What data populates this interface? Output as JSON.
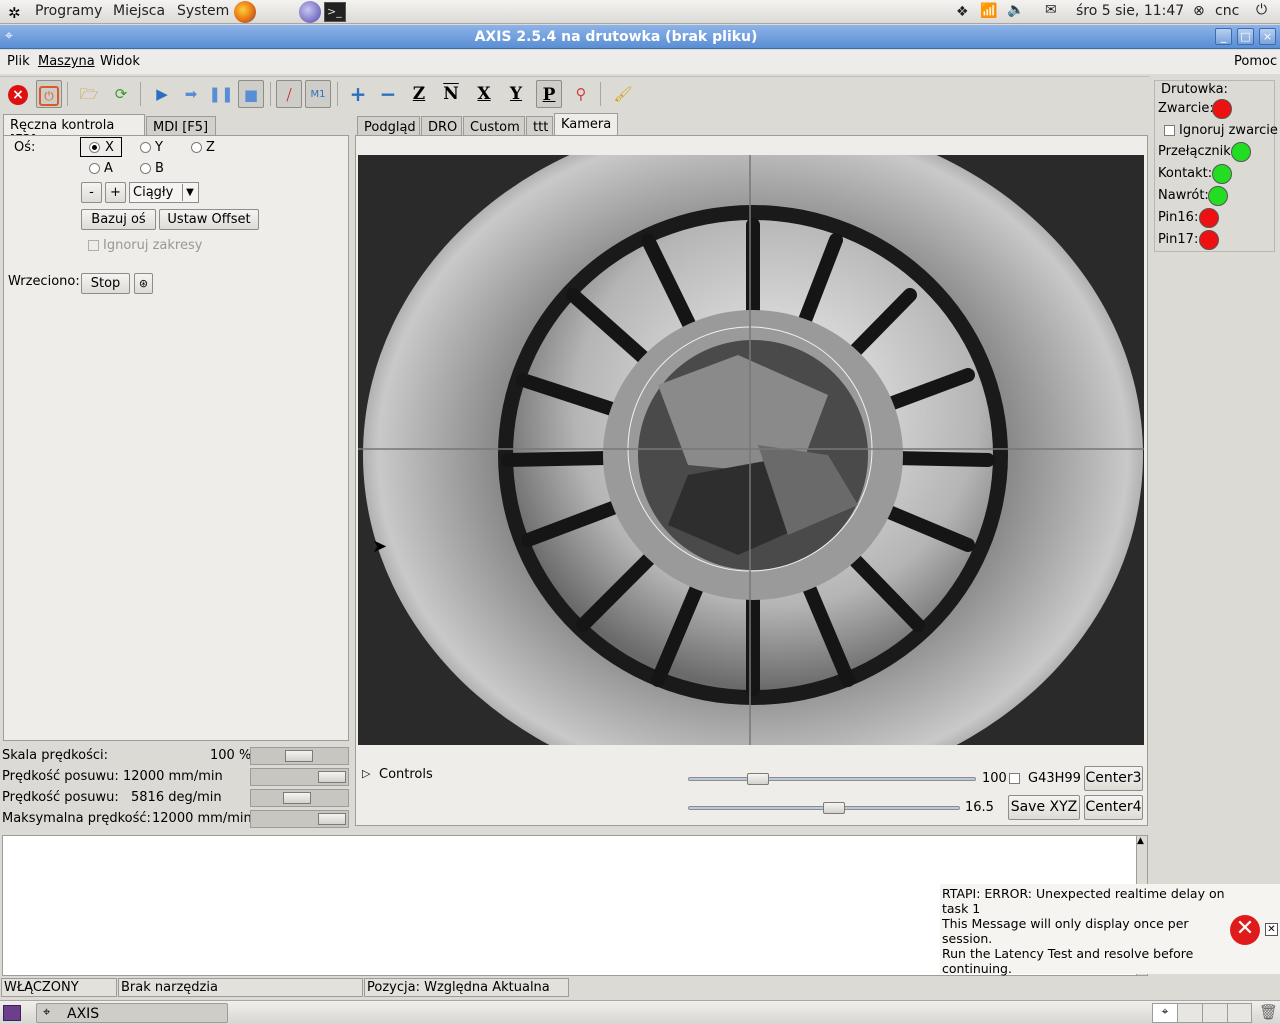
{
  "topbar": {
    "menus": [
      "Programy",
      "Miejsca",
      "System"
    ],
    "clock": "śro  5 sie, 11:47",
    "user": "cnc"
  },
  "window": {
    "title": "AXIS 2.5.4 na drutowka (brak pliku)"
  },
  "menubar": {
    "items": [
      "Plik",
      "Maszyna",
      "Widok"
    ],
    "help": "Pomoc"
  },
  "left_tabs": [
    "Ręczna kontrola [F3]",
    "MDI [F5]"
  ],
  "manual": {
    "axis_label": "Oś:",
    "axes": [
      "X",
      "Y",
      "Z",
      "A",
      "B"
    ],
    "selected_axis": "X",
    "minus": "-",
    "plus": "+",
    "jog_mode": "Ciągły",
    "home_button": "Bazuj oś",
    "offset_button": "Ustaw Offset",
    "ignore_limits": "Ignoruj zakresy",
    "spindle_label": "Wrzeciono:",
    "spindle_stop": "Stop"
  },
  "speeds": [
    {
      "label": "Skala prędkości:",
      "value": "100 %",
      "level": 0.5
    },
    {
      "label": "Prędkość posuwu:",
      "value": "12000 mm/min",
      "level": 1.0
    },
    {
      "label": "Prędkość posuwu:",
      "value": "5816 deg/min",
      "level": 0.48
    },
    {
      "label": "Maksymalna prędkość:",
      "value": "12000 mm/min",
      "level": 1.0
    }
  ],
  "view_tabs": [
    "Podgląd",
    "DRO",
    "Custom",
    "ttt",
    "Kamera"
  ],
  "active_view_tab": "Kamera",
  "camera_controls": {
    "controls_label": "Controls",
    "slider1_value": "100",
    "slider1_level": 0.22,
    "checkbox_label": "G43H99",
    "center3": "Center3",
    "slider2_value": "16.5",
    "slider2_level": 0.54,
    "save_xyz": "Save XYZ",
    "center4": "Center4"
  },
  "drutowka": {
    "title": "Drutowka:",
    "zwarcie": "Zwarcie:",
    "ignoruj": "Ignoruj zwarcie",
    "rows": [
      {
        "label": "Przełącznik:",
        "color": "#22dd22"
      },
      {
        "label": "Kontakt:",
        "color": "#22dd22"
      },
      {
        "label": "Nawrót:",
        "color": "#22dd22"
      },
      {
        "label": "Pin16:",
        "color": "#ee1111"
      },
      {
        "label": "Pin17:",
        "color": "#ee1111"
      }
    ],
    "zwarcie_color": "#ee1111"
  },
  "error": {
    "lines": [
      "RTAPI: ERROR: Unexpected realtime delay on",
      "task 1",
      "This Message will only display once per session.",
      "Run the Latency Test and resolve before",
      "continuing."
    ]
  },
  "statusbar": {
    "state": "WŁĄCZONY",
    "tool": "Brak narzędzia",
    "position": "Pozycja: Względna Aktualna"
  },
  "taskbar": {
    "item": "AXIS"
  }
}
